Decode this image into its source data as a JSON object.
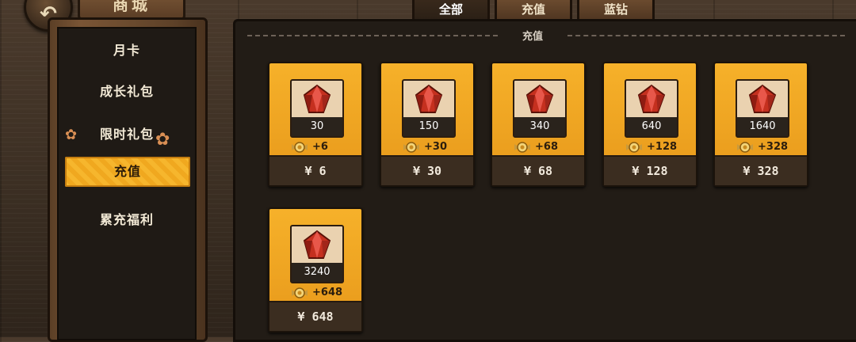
{
  "header": {
    "title": "商城",
    "tabs": [
      {
        "label": "全部",
        "active": true
      },
      {
        "label": "充值",
        "active": false
      },
      {
        "label": "蓝钻",
        "active": false
      }
    ]
  },
  "sidebar": {
    "items": [
      {
        "label": "月卡"
      },
      {
        "label": "成长礼包"
      },
      {
        "label": "限时礼包"
      },
      {
        "label": "充值",
        "active": true
      },
      {
        "label": "累充福利"
      }
    ]
  },
  "section": {
    "title": "充值"
  },
  "products": [
    {
      "amount": "30",
      "bonus": "+6",
      "price": "¥ 6"
    },
    {
      "amount": "150",
      "bonus": "+30",
      "price": "¥ 30"
    },
    {
      "amount": "340",
      "bonus": "+68",
      "price": "¥ 68"
    },
    {
      "amount": "640",
      "bonus": "+128",
      "price": "¥ 128"
    },
    {
      "amount": "1640",
      "bonus": "+328",
      "price": "¥ 328"
    },
    {
      "amount": "3240",
      "bonus": "+648",
      "price": "¥ 648"
    }
  ],
  "colors": {
    "accent": "#f6b12a",
    "panel": "#221c16",
    "price_bg": "#3b2d20"
  }
}
